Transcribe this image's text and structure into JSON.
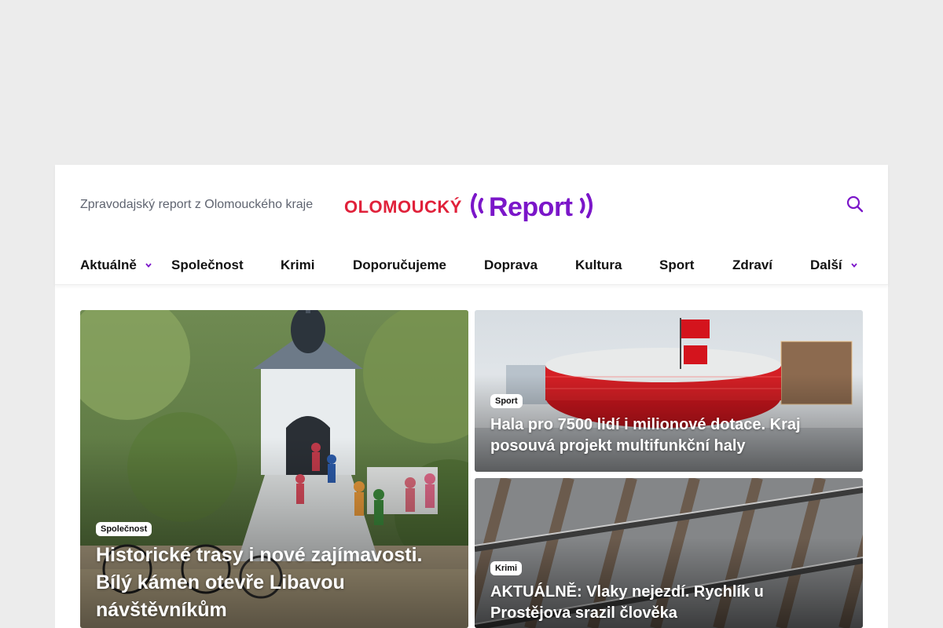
{
  "header": {
    "tagline": "Zpravodajský report z Olomouckého kraje",
    "logo": {
      "part1": "OLOMOUCKÝ",
      "part2": "Report",
      "color1": "#e0213a",
      "color2": "#7b16c9"
    }
  },
  "nav": {
    "items": [
      {
        "label": "Aktuálně",
        "has_dropdown": true
      },
      {
        "label": "Společnost",
        "has_dropdown": false
      },
      {
        "label": "Krimi",
        "has_dropdown": false
      },
      {
        "label": "Doporučujeme",
        "has_dropdown": false
      },
      {
        "label": "Doprava",
        "has_dropdown": false
      },
      {
        "label": "Kultura",
        "has_dropdown": false
      },
      {
        "label": "Sport",
        "has_dropdown": false
      },
      {
        "label": "Zdraví",
        "has_dropdown": false
      },
      {
        "label": "Další",
        "has_dropdown": true
      }
    ],
    "accent": "#7b16c9"
  },
  "articles": [
    {
      "category": "Společnost",
      "title": "Historické trasy i nové zajímavosti. Bílý kámen otevře Libavou návštěvníkům"
    },
    {
      "category": "Sport",
      "title": "Hala pro 7500 lidí i milionové dotace. Kraj posouvá projekt multifunkční haly"
    },
    {
      "category": "Krimi",
      "title": "AKTUÁLNĚ: Vlaky nejezdí. Rychlík u Prostějova srazil člověka"
    }
  ]
}
